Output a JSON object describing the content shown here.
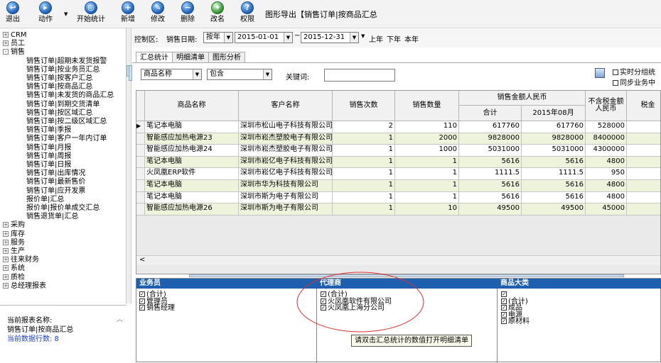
{
  "toolbar": {
    "items": [
      "退出",
      "动作",
      "开始统计",
      "新增",
      "修改",
      "删除",
      "改名",
      "权限"
    ],
    "dropdown_arrow": "▼"
  },
  "window_title": "图形导出【销售订单|按商品汇总",
  "tree": [
    {
      "t": "CRM",
      "l": 0,
      "exp": "+"
    },
    {
      "t": "员工",
      "l": 0,
      "exp": "+"
    },
    {
      "t": "销售",
      "l": 0,
      "exp": "-"
    },
    {
      "t": "销售订单|超期未发货报警",
      "l": 1
    },
    {
      "t": "销售订单|按业务员汇总",
      "l": 1
    },
    {
      "t": "销售订单|按客户汇总",
      "l": 1
    },
    {
      "t": "销售订单|按商品汇总",
      "l": 1
    },
    {
      "t": "销售订单|未发货的商品汇总",
      "l": 1
    },
    {
      "t": "销售订单|到期交货清单",
      "l": 1
    },
    {
      "t": "销售订单|按区域汇总",
      "l": 1
    },
    {
      "t": "销售订单|按二级区域汇总",
      "l": 1
    },
    {
      "t": "销售订单|季报",
      "l": 1
    },
    {
      "t": "销售订单|客户一年内订单",
      "l": 1
    },
    {
      "t": "销售订单|月报",
      "l": 1
    },
    {
      "t": "销售订单|周报",
      "l": 1
    },
    {
      "t": "销售订单|日报",
      "l": 1
    },
    {
      "t": "销售订单|出库情况",
      "l": 1
    },
    {
      "t": "销售订单|最新售价",
      "l": 1
    },
    {
      "t": "销售订单|应开发票",
      "l": 1
    },
    {
      "t": "报价单|汇总",
      "l": 1
    },
    {
      "t": "报价单|报价单成交汇总",
      "l": 1
    },
    {
      "t": "销售退货单|汇总",
      "l": 1
    },
    {
      "t": "采购",
      "l": 0,
      "exp": "+"
    },
    {
      "t": "库存",
      "l": 0,
      "exp": "+"
    },
    {
      "t": "服务",
      "l": 0,
      "exp": "+"
    },
    {
      "t": "生产",
      "l": 0,
      "exp": "+"
    },
    {
      "t": "往来财务",
      "l": 0,
      "exp": "+"
    },
    {
      "t": "系统",
      "l": 0,
      "exp": "+"
    },
    {
      "t": "质检",
      "l": 0,
      "exp": "+"
    },
    {
      "t": "总经理报表",
      "l": 0,
      "exp": "+"
    }
  ],
  "status": {
    "name_label": "当前报表名称:",
    "name_value": "销售订单|按商品汇总",
    "rows_text": "当前数据行数: 8"
  },
  "filter": {
    "area_label": "控制区:",
    "date_label": "销售日期:",
    "mode": "按年",
    "from": "2015-01-01",
    "tilde": "~",
    "to": "2015-12-31",
    "last_year": "上年",
    "next_year": "下年",
    "this_year": "本年"
  },
  "tabs": [
    "汇总统计",
    "明细清单",
    "图形分析"
  ],
  "search": {
    "field": "商品名称",
    "op": "包含",
    "kw_label": "关键词:",
    "kw_value": "",
    "opt1": "实时分组统",
    "opt2": "同步业务中"
  },
  "grid": {
    "headers": {
      "product": "商品名称",
      "customer": "客户名称",
      "times": "销售次数",
      "qty": "销售数量",
      "amount": "销售金额人民币",
      "sum": "合计",
      "month": "2015年08月",
      "notax": "不含税金额人民币",
      "tax": "税金"
    },
    "rows": [
      {
        "p": "笔记本电脑",
        "c": "深圳市松山电子科技有限公司",
        "n": "2",
        "q": "110",
        "s": "617760",
        "m": "617760",
        "nt": "528000"
      },
      {
        "p": "智能感应加热电源23",
        "c": "深圳市崧杰塑胶电子有限公司",
        "n": "1",
        "q": "2000",
        "s": "9828000",
        "m": "9828000",
        "nt": "8400000"
      },
      {
        "p": "智能感应加热电源24",
        "c": "深圳市崧杰塑胶电子有限公司",
        "n": "1",
        "q": "1000",
        "s": "5031000",
        "m": "5031000",
        "nt": "4300000"
      },
      {
        "p": "笔记本电脑",
        "c": "深圳市崧亿电子科技有限公司",
        "n": "1",
        "q": "1",
        "s": "5616",
        "m": "5616",
        "nt": "4800"
      },
      {
        "p": "火凤凰ERP软件",
        "c": "深圳市崧亿电子科技有限公司",
        "n": "1",
        "q": "1",
        "s": "1111.5",
        "m": "1111.5",
        "nt": "950"
      },
      {
        "p": "笔记本电脑",
        "c": "深圳市华为科技有限公司",
        "n": "1",
        "q": "1",
        "s": "5616",
        "m": "5616",
        "nt": "4800"
      },
      {
        "p": "笔记本电脑",
        "c": "深圳市斯为电子有限公司",
        "n": "1",
        "q": "1",
        "s": "5616",
        "m": "5616",
        "nt": "4800"
      },
      {
        "p": "智能感应加热电源26",
        "c": "深圳市斯为电子有限公司",
        "n": "1",
        "q": "10",
        "s": "49500",
        "m": "49500",
        "nt": "45000"
      }
    ]
  },
  "panels": {
    "salesman": {
      "title": "业务员",
      "items": [
        "(合计)",
        "管理员",
        "销售经理"
      ]
    },
    "agent": {
      "title": "代理商",
      "items": [
        "(合计)",
        "火凤凰软件有限公司",
        "火凤凰上海分公司"
      ]
    },
    "category": {
      "title": "商品大类",
      "items": [
        "",
        "(合计)",
        "成品",
        "电源",
        "原材料"
      ]
    }
  },
  "tooltip": "请双击汇总统计的数值打开明细清单",
  "colors": {
    "header_blue": "#1f5fb0",
    "row_alt": "#eef4dc",
    "annotation": "#e03030"
  }
}
